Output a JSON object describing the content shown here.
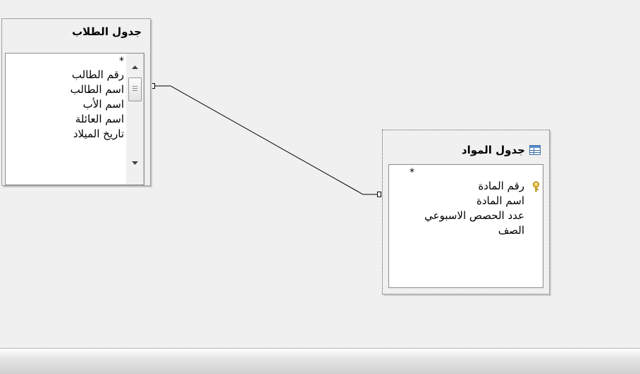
{
  "tables": {
    "students": {
      "title": "جدول الطلاب",
      "fields": [
        "*",
        "رقم الطالب",
        "اسم الطالب",
        "اسم الأب",
        "اسم العائلة",
        "تاريخ الميلاد"
      ]
    },
    "subjects": {
      "title": "جدول المواد",
      "fields": [
        "*",
        "رقم المادة",
        "اسم المادة",
        "عدد الحصص الاسبوعي",
        "الصف"
      ],
      "primary_key_field": "رقم المادة"
    }
  },
  "icons": {
    "primary_key": "key-icon",
    "table": "table-icon",
    "scroll_up": "scroll-up-arrow-icon",
    "scroll_down": "scroll-down-arrow-icon"
  },
  "colors": {
    "canvas": "#f0f0f0",
    "key": "#e0b020"
  }
}
